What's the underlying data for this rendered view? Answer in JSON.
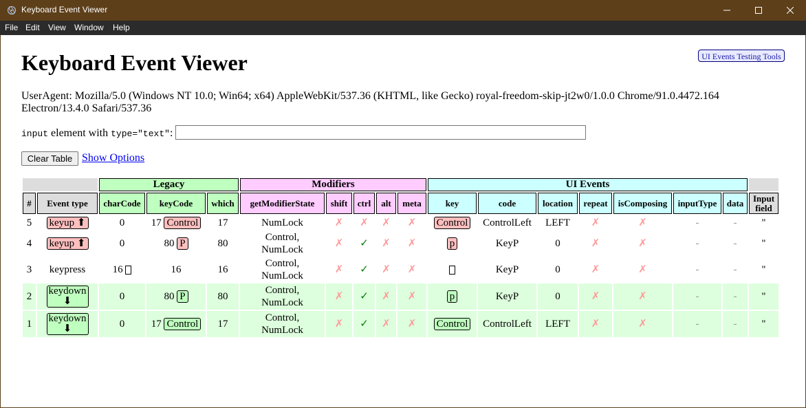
{
  "window": {
    "title": "Keyboard Event Viewer",
    "minimize_icon": "minimize-icon",
    "maximize_icon": "maximize-icon",
    "close_icon": "close-icon"
  },
  "menu": [
    "File",
    "Edit",
    "View",
    "Window",
    "Help"
  ],
  "page": {
    "title": "Keyboard Event Viewer",
    "tools_button": "UI Events Testing Tools",
    "useragent": "UserAgent: Mozilla/5.0 (Windows NT 10.0; Win64; x64) AppleWebKit/537.36 (KHTML, like Gecko) royal-freedom-skip-jt2w0/1.0.0 Chrome/91.0.4472.164 Electron/13.4.0 Safari/537.36",
    "input_label_code1": "input",
    "input_label_text1": " element with ",
    "input_label_code2": "type=\"text\"",
    "input_label_text2": ":",
    "input_value": "",
    "clear_button": "Clear Table",
    "show_options": "Show Options"
  },
  "table": {
    "groups": {
      "legacy": "Legacy",
      "modifiers": "Modifiers",
      "ui_events": "UI Events"
    },
    "headers": [
      "#",
      "Event type",
      "charCode",
      "keyCode",
      "which",
      "getModifierState",
      "shift",
      "ctrl",
      "alt",
      "meta",
      "key",
      "code",
      "location",
      "repeat",
      "isComposing",
      "inputType",
      "data",
      "Input field"
    ],
    "rows": [
      {
        "n": "5",
        "type": "keyup",
        "arrow": "⬆",
        "kind": "up",
        "charCode": "0",
        "keyCodeNum": "17",
        "keyCodeLabel": "Control",
        "which": "17",
        "mods1": "NumLock",
        "mods2": "",
        "shift": "✗",
        "ctrl": "✗",
        "alt": "✗",
        "meta": "✗",
        "key": "Control",
        "code": "ControlLeft",
        "location": "LEFT",
        "repeat": "✗",
        "isComposing": "✗",
        "inputType": "-",
        "data": "-",
        "field": "''"
      },
      {
        "n": "4",
        "type": "keyup",
        "arrow": "⬆",
        "kind": "up",
        "charCode": "0",
        "keyCodeNum": "80",
        "keyCodeLabel": "P",
        "which": "80",
        "mods1": "Control,",
        "mods2": "NumLock",
        "shift": "✗",
        "ctrl": "✓",
        "alt": "✗",
        "meta": "✗",
        "key": "p",
        "code": "KeyP",
        "location": "0",
        "repeat": "✗",
        "isComposing": "✗",
        "inputType": "-",
        "data": "-",
        "field": "''"
      },
      {
        "n": "3",
        "type": "keypress",
        "arrow": "",
        "kind": "press",
        "charCode": "16",
        "keyCodeNum": "16",
        "keyCodeLabel": "",
        "which": "16",
        "mods1": "Control,",
        "mods2": "NumLock",
        "shift": "✗",
        "ctrl": "✓",
        "alt": "✗",
        "meta": "✗",
        "key": "",
        "code": "KeyP",
        "location": "0",
        "repeat": "✗",
        "isComposing": "✗",
        "inputType": "-",
        "data": "-",
        "field": "''"
      },
      {
        "n": "2",
        "type": "keydown",
        "arrow": "⬇",
        "kind": "down",
        "charCode": "0",
        "keyCodeNum": "80",
        "keyCodeLabel": "P",
        "which": "80",
        "mods1": "Control,",
        "mods2": "NumLock",
        "shift": "✗",
        "ctrl": "✓",
        "alt": "✗",
        "meta": "✗",
        "key": "p",
        "code": "KeyP",
        "location": "0",
        "repeat": "✗",
        "isComposing": "✗",
        "inputType": "-",
        "data": "-",
        "field": "''"
      },
      {
        "n": "1",
        "type": "keydown",
        "arrow": "⬇",
        "kind": "down",
        "charCode": "0",
        "keyCodeNum": "17",
        "keyCodeLabel": "Control",
        "which": "17",
        "mods1": "Control,",
        "mods2": "NumLock",
        "shift": "✗",
        "ctrl": "✓",
        "alt": "✗",
        "meta": "✗",
        "key": "Control",
        "code": "ControlLeft",
        "location": "LEFT",
        "repeat": "✗",
        "isComposing": "✗",
        "inputType": "-",
        "data": "-",
        "field": "''"
      }
    ]
  },
  "colors": {
    "titlebar": "#5d3f1a",
    "menubar": "#2b2b2b",
    "legacy": "#bfffbf",
    "modifiers": "#ffccff",
    "ui_events": "#ccffff",
    "keydown_row": "#ddffdd",
    "keyup_badge": "#ffbfbf"
  }
}
